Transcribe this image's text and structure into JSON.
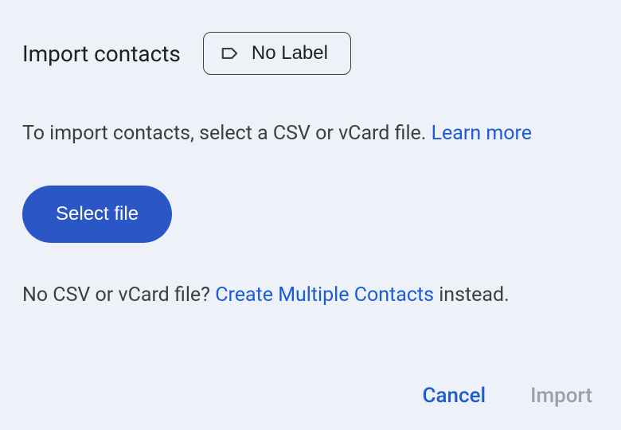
{
  "dialog": {
    "title": "Import contacts",
    "labelChip": {
      "text": "No Label"
    },
    "description": {
      "text": "To import contacts, select a CSV or vCard file. ",
      "linkText": "Learn more"
    },
    "selectFileLabel": "Select file",
    "altText": {
      "prefix": "No CSV or vCard file? ",
      "linkText": "Create Multiple Contacts",
      "suffix": " instead."
    },
    "footer": {
      "cancelLabel": "Cancel",
      "importLabel": "Import"
    }
  }
}
